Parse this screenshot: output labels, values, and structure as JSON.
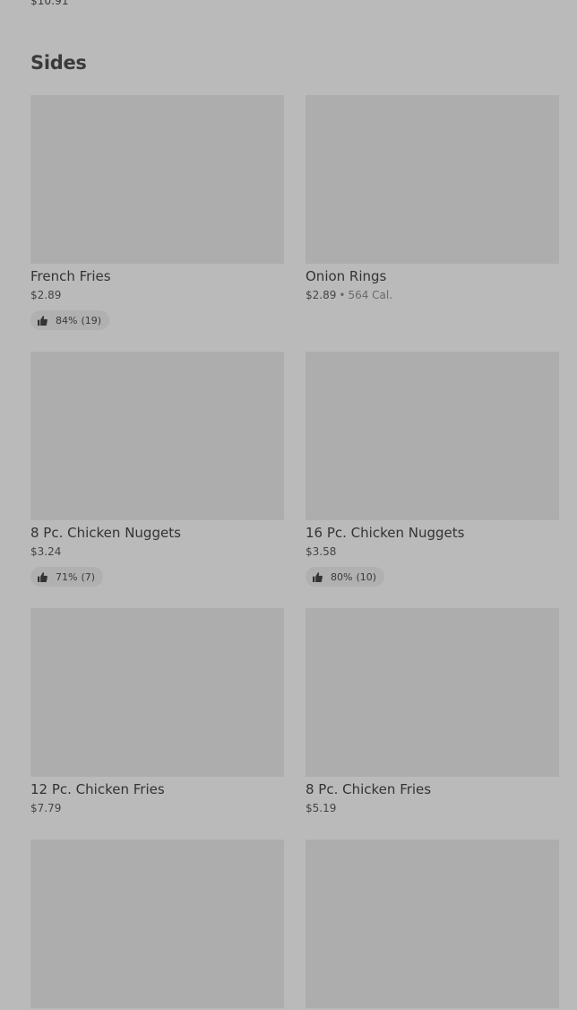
{
  "previous_item": {
    "price": "$10.91"
  },
  "section": {
    "title": "Sides"
  },
  "items": [
    {
      "name": "French Fries",
      "price": "$2.89",
      "calories": "",
      "rating": {
        "percent": "84%",
        "count": "(19)"
      }
    },
    {
      "name": "Onion Rings",
      "price": "$2.89",
      "calories": "564 Cal.",
      "rating": null
    },
    {
      "name": "8 Pc. Chicken Nuggets",
      "price": "$3.24",
      "calories": "",
      "rating": {
        "percent": "71%",
        "count": "(7)"
      }
    },
    {
      "name": "16 Pc. Chicken Nuggets",
      "price": "$3.58",
      "calories": "",
      "rating": {
        "percent": "80%",
        "count": "(10)"
      }
    },
    {
      "name": "12 Pc. Chicken Fries",
      "price": "$7.79",
      "calories": "",
      "rating": null
    },
    {
      "name": "8 Pc. Chicken Fries",
      "price": "$5.19",
      "calories": "",
      "rating": null
    },
    {
      "name": "",
      "price": "",
      "calories": "",
      "rating": null
    },
    {
      "name": "",
      "price": "",
      "calories": "",
      "rating": null
    }
  ],
  "icons": {
    "rating": "thumbs-up-icon"
  },
  "colors": {
    "background": "#bababa",
    "image_placeholder": "#adadad",
    "pill": "#b0b0b0"
  }
}
